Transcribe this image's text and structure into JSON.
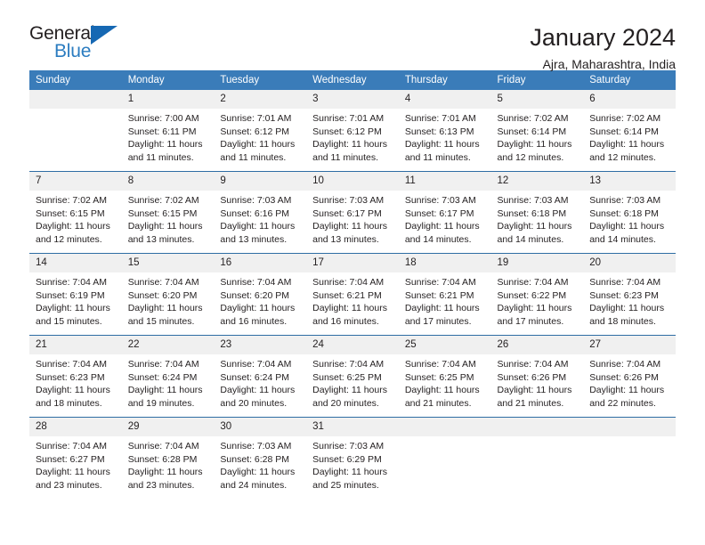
{
  "brand": {
    "word_one": "General",
    "word_two": "Blue",
    "triangle_icon": "triangle-logo-icon",
    "accent_color": "#2b7cc0"
  },
  "header": {
    "title": "January 2024",
    "subtitle": "Ajra, Maharashtra, India"
  },
  "calendar": {
    "header_bg": "#3a7cb9",
    "daynum_bg": "#f0f0f0",
    "row_divider": "#2e6da4",
    "weekday_headers": [
      "Sunday",
      "Monday",
      "Tuesday",
      "Wednesday",
      "Thursday",
      "Friday",
      "Saturday"
    ],
    "weeks": [
      [
        {
          "day": "",
          "lines": []
        },
        {
          "day": "1",
          "lines": [
            "Sunrise: 7:00 AM",
            "Sunset: 6:11 PM",
            "Daylight: 11 hours",
            "and 11 minutes."
          ]
        },
        {
          "day": "2",
          "lines": [
            "Sunrise: 7:01 AM",
            "Sunset: 6:12 PM",
            "Daylight: 11 hours",
            "and 11 minutes."
          ]
        },
        {
          "day": "3",
          "lines": [
            "Sunrise: 7:01 AM",
            "Sunset: 6:12 PM",
            "Daylight: 11 hours",
            "and 11 minutes."
          ]
        },
        {
          "day": "4",
          "lines": [
            "Sunrise: 7:01 AM",
            "Sunset: 6:13 PM",
            "Daylight: 11 hours",
            "and 11 minutes."
          ]
        },
        {
          "day": "5",
          "lines": [
            "Sunrise: 7:02 AM",
            "Sunset: 6:14 PM",
            "Daylight: 11 hours",
            "and 12 minutes."
          ]
        },
        {
          "day": "6",
          "lines": [
            "Sunrise: 7:02 AM",
            "Sunset: 6:14 PM",
            "Daylight: 11 hours",
            "and 12 minutes."
          ]
        }
      ],
      [
        {
          "day": "7",
          "lines": [
            "Sunrise: 7:02 AM",
            "Sunset: 6:15 PM",
            "Daylight: 11 hours",
            "and 12 minutes."
          ]
        },
        {
          "day": "8",
          "lines": [
            "Sunrise: 7:02 AM",
            "Sunset: 6:15 PM",
            "Daylight: 11 hours",
            "and 13 minutes."
          ]
        },
        {
          "day": "9",
          "lines": [
            "Sunrise: 7:03 AM",
            "Sunset: 6:16 PM",
            "Daylight: 11 hours",
            "and 13 minutes."
          ]
        },
        {
          "day": "10",
          "lines": [
            "Sunrise: 7:03 AM",
            "Sunset: 6:17 PM",
            "Daylight: 11 hours",
            "and 13 minutes."
          ]
        },
        {
          "day": "11",
          "lines": [
            "Sunrise: 7:03 AM",
            "Sunset: 6:17 PM",
            "Daylight: 11 hours",
            "and 14 minutes."
          ]
        },
        {
          "day": "12",
          "lines": [
            "Sunrise: 7:03 AM",
            "Sunset: 6:18 PM",
            "Daylight: 11 hours",
            "and 14 minutes."
          ]
        },
        {
          "day": "13",
          "lines": [
            "Sunrise: 7:03 AM",
            "Sunset: 6:18 PM",
            "Daylight: 11 hours",
            "and 14 minutes."
          ]
        }
      ],
      [
        {
          "day": "14",
          "lines": [
            "Sunrise: 7:04 AM",
            "Sunset: 6:19 PM",
            "Daylight: 11 hours",
            "and 15 minutes."
          ]
        },
        {
          "day": "15",
          "lines": [
            "Sunrise: 7:04 AM",
            "Sunset: 6:20 PM",
            "Daylight: 11 hours",
            "and 15 minutes."
          ]
        },
        {
          "day": "16",
          "lines": [
            "Sunrise: 7:04 AM",
            "Sunset: 6:20 PM",
            "Daylight: 11 hours",
            "and 16 minutes."
          ]
        },
        {
          "day": "17",
          "lines": [
            "Sunrise: 7:04 AM",
            "Sunset: 6:21 PM",
            "Daylight: 11 hours",
            "and 16 minutes."
          ]
        },
        {
          "day": "18",
          "lines": [
            "Sunrise: 7:04 AM",
            "Sunset: 6:21 PM",
            "Daylight: 11 hours",
            "and 17 minutes."
          ]
        },
        {
          "day": "19",
          "lines": [
            "Sunrise: 7:04 AM",
            "Sunset: 6:22 PM",
            "Daylight: 11 hours",
            "and 17 minutes."
          ]
        },
        {
          "day": "20",
          "lines": [
            "Sunrise: 7:04 AM",
            "Sunset: 6:23 PM",
            "Daylight: 11 hours",
            "and 18 minutes."
          ]
        }
      ],
      [
        {
          "day": "21",
          "lines": [
            "Sunrise: 7:04 AM",
            "Sunset: 6:23 PM",
            "Daylight: 11 hours",
            "and 18 minutes."
          ]
        },
        {
          "day": "22",
          "lines": [
            "Sunrise: 7:04 AM",
            "Sunset: 6:24 PM",
            "Daylight: 11 hours",
            "and 19 minutes."
          ]
        },
        {
          "day": "23",
          "lines": [
            "Sunrise: 7:04 AM",
            "Sunset: 6:24 PM",
            "Daylight: 11 hours",
            "and 20 minutes."
          ]
        },
        {
          "day": "24",
          "lines": [
            "Sunrise: 7:04 AM",
            "Sunset: 6:25 PM",
            "Daylight: 11 hours",
            "and 20 minutes."
          ]
        },
        {
          "day": "25",
          "lines": [
            "Sunrise: 7:04 AM",
            "Sunset: 6:25 PM",
            "Daylight: 11 hours",
            "and 21 minutes."
          ]
        },
        {
          "day": "26",
          "lines": [
            "Sunrise: 7:04 AM",
            "Sunset: 6:26 PM",
            "Daylight: 11 hours",
            "and 21 minutes."
          ]
        },
        {
          "day": "27",
          "lines": [
            "Sunrise: 7:04 AM",
            "Sunset: 6:26 PM",
            "Daylight: 11 hours",
            "and 22 minutes."
          ]
        }
      ],
      [
        {
          "day": "28",
          "lines": [
            "Sunrise: 7:04 AM",
            "Sunset: 6:27 PM",
            "Daylight: 11 hours",
            "and 23 minutes."
          ]
        },
        {
          "day": "29",
          "lines": [
            "Sunrise: 7:04 AM",
            "Sunset: 6:28 PM",
            "Daylight: 11 hours",
            "and 23 minutes."
          ]
        },
        {
          "day": "30",
          "lines": [
            "Sunrise: 7:03 AM",
            "Sunset: 6:28 PM",
            "Daylight: 11 hours",
            "and 24 minutes."
          ]
        },
        {
          "day": "31",
          "lines": [
            "Sunrise: 7:03 AM",
            "Sunset: 6:29 PM",
            "Daylight: 11 hours",
            "and 25 minutes."
          ]
        },
        {
          "day": "",
          "lines": []
        },
        {
          "day": "",
          "lines": []
        },
        {
          "day": "",
          "lines": []
        }
      ]
    ]
  }
}
